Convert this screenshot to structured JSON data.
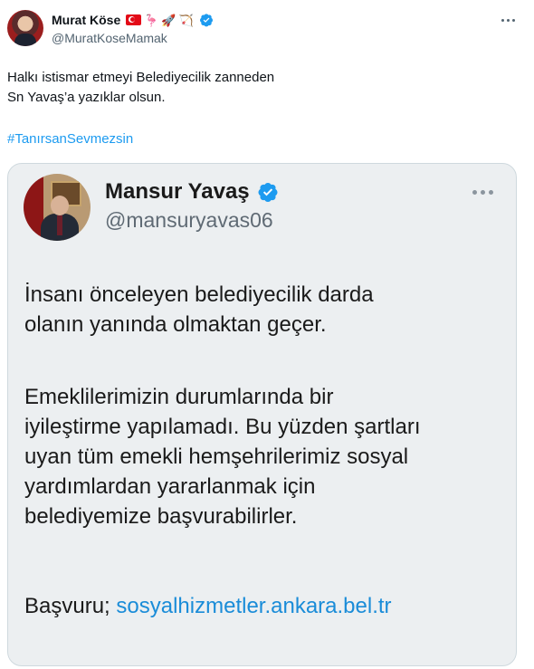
{
  "author": {
    "name": "Murat Köse",
    "handle": "@MuratKoseMamak",
    "emojis": [
      "🦩",
      "🚀",
      "🏹"
    ]
  },
  "tweet": {
    "line1": "Halkı istismar etmeyi Belediyecilik zanneden",
    "line2": "Sn Yavaş’a yazıklar olsun.",
    "hashtag": "#TanırsanSevmezsin"
  },
  "quoted": {
    "name": "Mansur Yavaş",
    "handle": "@mansuryavas06",
    "paragraph1": [
      "İnsanı önceleyen belediyecilik darda",
      "olanın yanında olmaktan geçer."
    ],
    "paragraph2": [
      "Emeklilerimizin durumlarında bir",
      "iyileştirme yapılamadı. Bu yüzden şartları",
      "uyan tüm emekli hemşehrilerimiz sosyal",
      "yardımlardan yararlanmak için",
      "belediyemize başvurabilirler."
    ],
    "apply_label": "Başvuru;",
    "apply_link": "sosyalhizmetler.ankara.bel.tr"
  },
  "colors": {
    "accent": "#1d9bf0",
    "verified": "#1d9bf0",
    "muted": "#536471"
  },
  "icons": {
    "verified": "verified-badge-icon",
    "more": "more-options-icon",
    "flag": "turkey-flag-icon"
  }
}
